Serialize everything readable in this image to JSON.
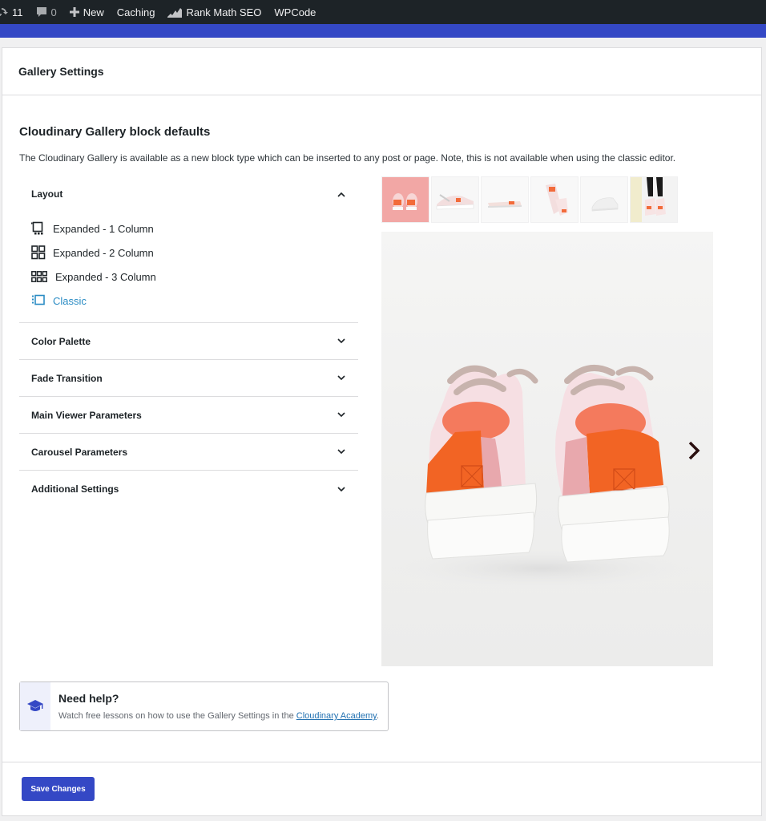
{
  "adminbar": {
    "updates_count": "11",
    "comments_count": "0",
    "new_label": "New",
    "caching_label": "Caching",
    "rankmath_label": "Rank Math SEO",
    "wpcode_label": "WPCode"
  },
  "panel": {
    "header_title": "Gallery Settings",
    "section_title": "Cloudinary Gallery block defaults",
    "section_desc": "The Cloudinary Gallery is available as a new block type which can be inserted to any post or page. Note, this is not available when using the classic editor."
  },
  "layout": {
    "label": "Layout",
    "options": [
      {
        "label": "Expanded - 1 Column",
        "icon": "single-column-icon"
      },
      {
        "label": "Expanded - 2 Column",
        "icon": "two-column-grid-icon"
      },
      {
        "label": "Expanded - 3 Column",
        "icon": "three-column-grid-icon"
      },
      {
        "label": "Classic",
        "icon": "classic-layout-icon",
        "selected": true
      }
    ]
  },
  "accordion": [
    {
      "label": "Color Palette"
    },
    {
      "label": "Fade Transition"
    },
    {
      "label": "Main Viewer Parameters"
    },
    {
      "label": "Carousel Parameters"
    },
    {
      "label": "Additional Settings"
    }
  ],
  "gallery": {
    "thumbnail_count": 6,
    "selected_thumbnail": 1
  },
  "help": {
    "title": "Need help?",
    "desc_prefix": "Watch free lessons on how to use the Gallery Settings in the ",
    "link_text": "Cloudinary Academy",
    "desc_suffix": "."
  },
  "footer": {
    "save_label": "Save Changes"
  },
  "colors": {
    "accent": "#3448c5",
    "adminbar": "#1d2327",
    "link": "#2271b1"
  }
}
